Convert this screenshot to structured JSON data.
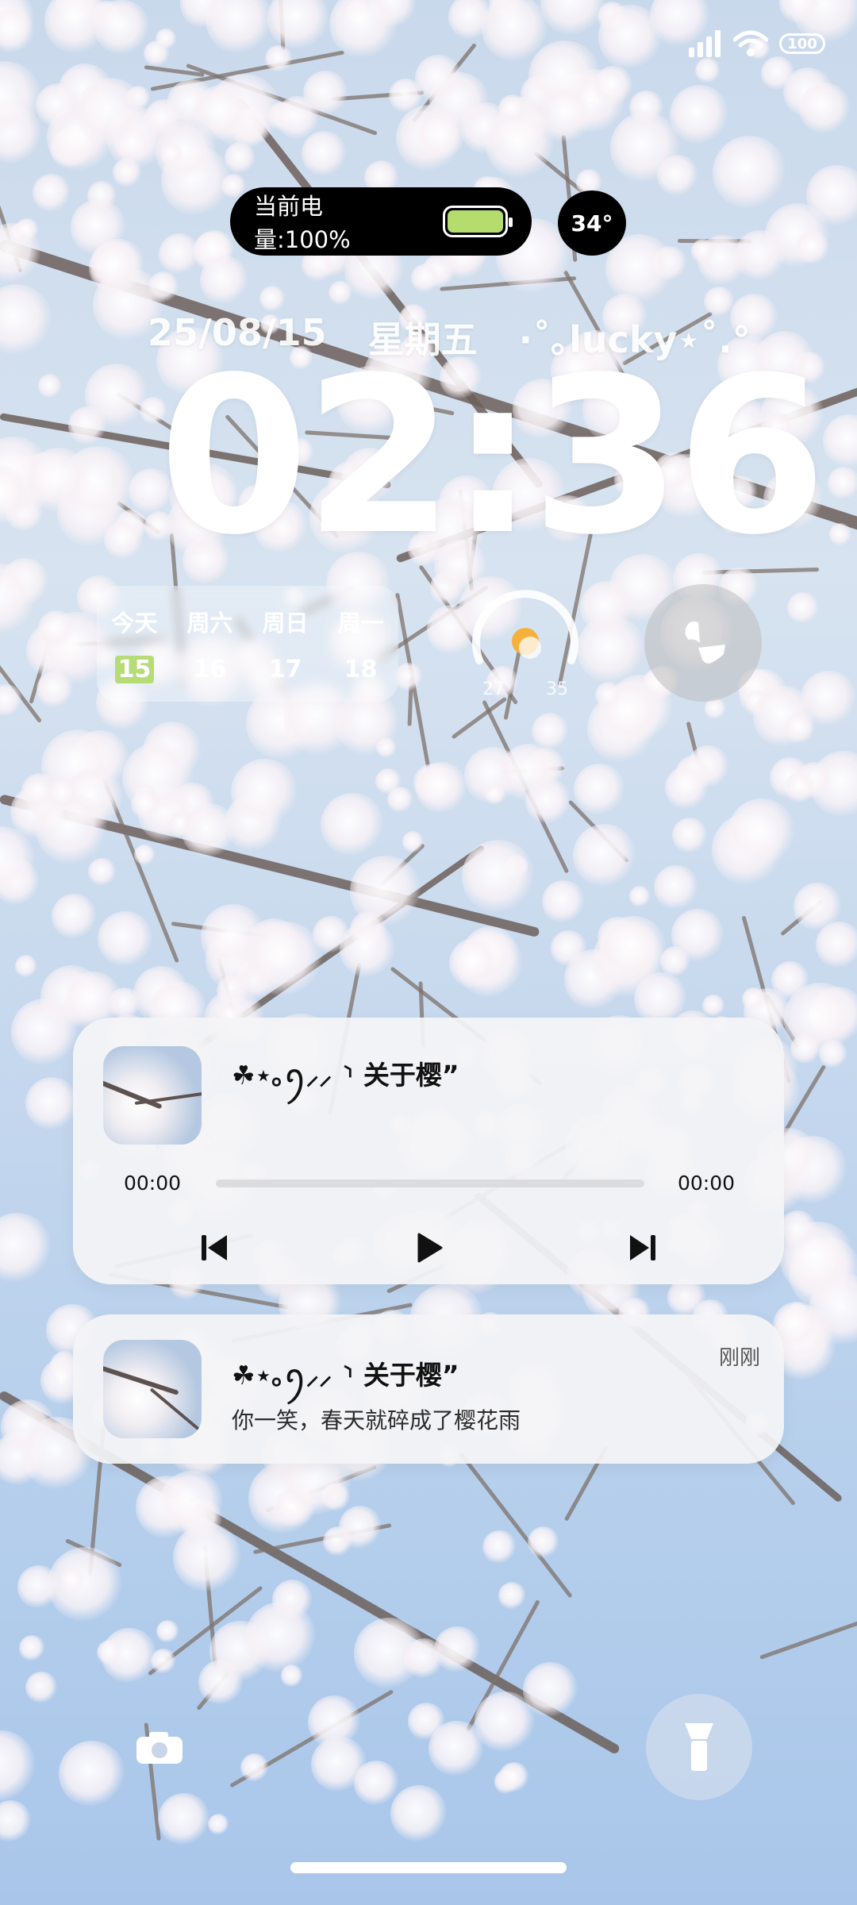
{
  "status_bar": {
    "battery_level": "100"
  },
  "island": {
    "label": "当前电量:100%",
    "battery_fill": 1.0,
    "temp": "34°"
  },
  "lock": {
    "date": "25/08/15",
    "weekday": "星期五",
    "signature": "·˚｡lucky⋆˚.°",
    "time": "02:36"
  },
  "calendar": {
    "headers": [
      "今天",
      "周六",
      "周日",
      "周一"
    ],
    "days": [
      "15",
      "16",
      "17",
      "18"
    ]
  },
  "weather": {
    "low": "27",
    "high": "35",
    "icon": "sun-icon"
  },
  "music": {
    "title": "☘︎⋆｡ꪆ⸝⸝ ⸃ 关于樱”",
    "current_time": "00:00",
    "total_time": "00:00",
    "progress": 0.0
  },
  "notification": {
    "title": "☘︎⋆｡ꪆ⸝⸝ ⸃ 关于樱”",
    "message": "你一笑，春天就碎成了樱花雨",
    "time": "刚刚"
  },
  "colors": {
    "accent_green": "#b6dc78",
    "island_bg": "#000000"
  }
}
